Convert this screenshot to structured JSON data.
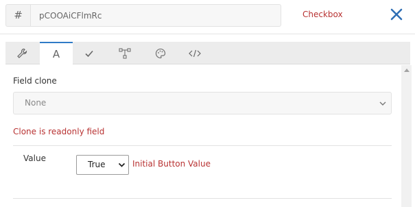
{
  "header": {
    "id_prefix": "#",
    "id_value": "pCOOAiCFlmRc",
    "type_label": "Checkbox",
    "close_icon": "close-icon"
  },
  "tabs": [
    {
      "icon": "wrench-icon",
      "glyph": "🔧",
      "active": false
    },
    {
      "icon": "text-icon",
      "glyph": "A",
      "active": true
    },
    {
      "icon": "check-icon",
      "glyph": "✓",
      "active": false
    },
    {
      "icon": "hierarchy-icon",
      "glyph": "⧉",
      "active": false
    },
    {
      "icon": "palette-icon",
      "glyph": "◔",
      "active": false
    },
    {
      "icon": "code-icon",
      "glyph": "</>",
      "active": false
    }
  ],
  "field_clone": {
    "label": "Field clone",
    "selected": "None",
    "warning": "Clone is readonly field"
  },
  "value_row": {
    "label": "Value",
    "selected": "True",
    "hint": "Initial Button Value"
  },
  "colors": {
    "accent": "#2f7bc6",
    "warning": "#b83232"
  }
}
